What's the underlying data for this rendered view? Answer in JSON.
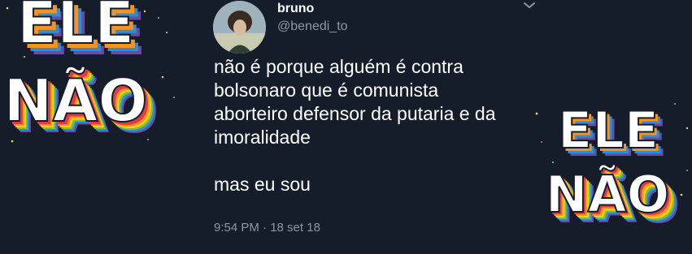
{
  "tweet": {
    "display_name": "bruno",
    "handle": "@benedi_to",
    "text_lines": [
      "não é porque alguém é contra",
      "bolsonaro que é comunista",
      "aborteiro defensor da putaria e da",
      "imoralidade"
    ],
    "second_paragraph": "mas eu sou",
    "timestamp": "9:54 PM · 18 set 18"
  },
  "stickers": {
    "left": {
      "line1": "ELE",
      "line2": "NÃO"
    },
    "right": {
      "line1": "ELE",
      "line2": "NÃO"
    }
  },
  "colors": {
    "background": "#151d2a",
    "text_primary": "#ffffff",
    "text_secondary": "#8899a6",
    "rainbow": [
      "#e8393f",
      "#f7941d",
      "#fcd20f",
      "#7ac143",
      "#2e8ede",
      "#6a4c9c"
    ]
  },
  "icons": {
    "options": "chevron-down-icon",
    "avatar": "user-avatar"
  }
}
